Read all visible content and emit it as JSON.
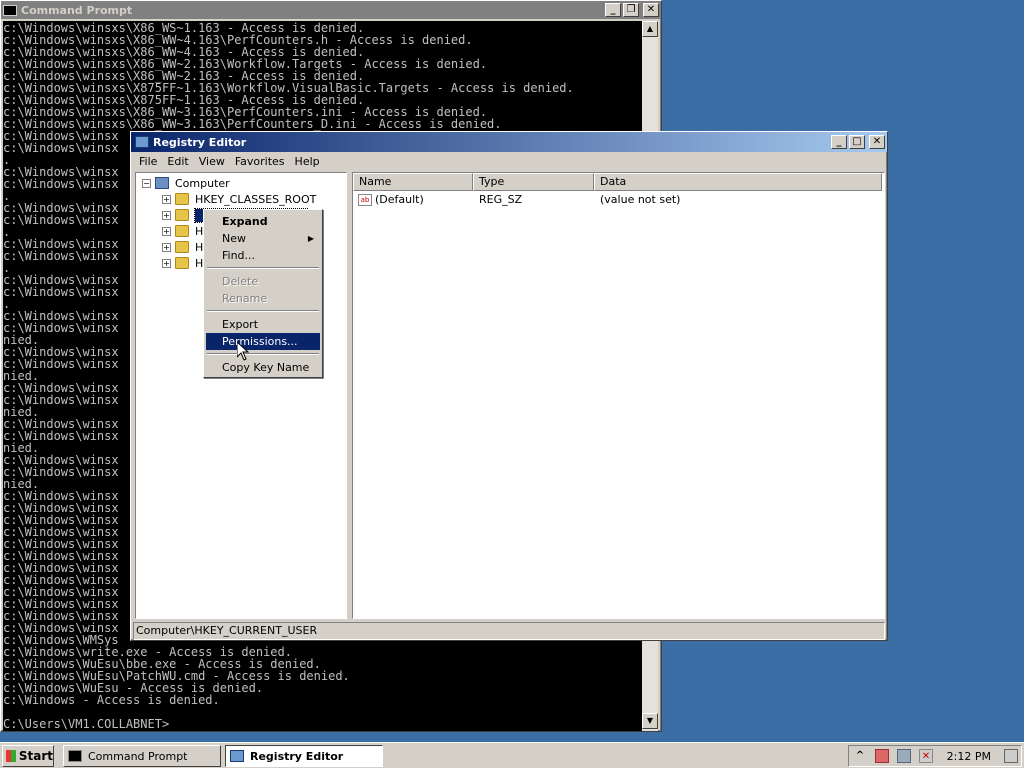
{
  "cmd": {
    "title": "Command Prompt",
    "lines": [
      "c:\\Windows\\winsxs\\X86_WS~1.163 - Access is denied.",
      "c:\\Windows\\winsxs\\X86_WW~4.163\\PerfCounters.h - Access is denied.",
      "c:\\Windows\\winsxs\\X86_WW~4.163 - Access is denied.",
      "c:\\Windows\\winsxs\\X86_WW~2.163\\Workflow.Targets - Access is denied.",
      "c:\\Windows\\winsxs\\X86_WW~2.163 - Access is denied.",
      "c:\\Windows\\winsxs\\X875FF~1.163\\Workflow.VisualBasic.Targets - Access is denied.",
      "c:\\Windows\\winsxs\\X875FF~1.163 - Access is denied.",
      "c:\\Windows\\winsxs\\X86_WW~3.163\\PerfCounters.ini - Access is denied.",
      "c:\\Windows\\winsxs\\X86_WW~3.163\\PerfCounters_D.ini - Access is denied.",
      "c:\\Windows\\winsx",
      "c:\\Windows\\winsx",
      ".",
      "c:\\Windows\\winsx",
      "c:\\Windows\\winsx",
      ".",
      "c:\\Windows\\winsx",
      "c:\\Windows\\winsx",
      ".",
      "c:\\Windows\\winsx",
      "c:\\Windows\\winsx",
      ".",
      "c:\\Windows\\winsx",
      "c:\\Windows\\winsx",
      ".",
      "c:\\Windows\\winsx",
      "c:\\Windows\\winsx",
      "nied.",
      "c:\\Windows\\winsx",
      "c:\\Windows\\winsx",
      "nied.",
      "c:\\Windows\\winsx",
      "c:\\Windows\\winsx",
      "nied.",
      "c:\\Windows\\winsx",
      "c:\\Windows\\winsx",
      "nied.",
      "c:\\Windows\\winsx",
      "c:\\Windows\\winsx",
      "nied.",
      "c:\\Windows\\winsx",
      "c:\\Windows\\winsx",
      "c:\\Windows\\winsx",
      "c:\\Windows\\winsx",
      "c:\\Windows\\winsx",
      "c:\\Windows\\winsx",
      "c:\\Windows\\winsx",
      "c:\\Windows\\winsx",
      "c:\\Windows\\winsx",
      "c:\\Windows\\winsx",
      "c:\\Windows\\winsx",
      "c:\\Windows\\winsx",
      "c:\\Windows\\WMSys",
      "c:\\Windows\\write.exe - Access is denied.",
      "c:\\Windows\\WuEsu\\bbe.exe - Access is denied.",
      "c:\\Windows\\WuEsu\\PatchWU.cmd - Access is denied.",
      "c:\\Windows\\WuEsu - Access is denied.",
      "c:\\Windows - Access is denied.",
      "",
      "C:\\Users\\VM1.COLLABNET>"
    ]
  },
  "regedit": {
    "title": "Registry Editor",
    "menu": [
      "File",
      "Edit",
      "View",
      "Favorites",
      "Help"
    ],
    "tree": {
      "root": "Computer",
      "items": [
        "HKEY_CLASSES_ROOT",
        "H",
        "H",
        "H",
        "H"
      ]
    },
    "columns": [
      "Name",
      "Type",
      "Data"
    ],
    "rows": [
      {
        "name": "(Default)",
        "type": "REG_SZ",
        "data": "(value not set)"
      }
    ],
    "status": "Computer\\HKEY_CURRENT_USER"
  },
  "context_menu": {
    "expand": "Expand",
    "new": "New",
    "find": "Find...",
    "delete": "Delete",
    "rename": "Rename",
    "export": "Export",
    "permissions": "Permissions...",
    "copy_key_name": "Copy Key Name"
  },
  "taskbar": {
    "start": "Start",
    "tasks": [
      "Command Prompt",
      "Registry Editor"
    ],
    "clock": "2:12 PM"
  },
  "icons": {
    "minimize": "_",
    "maximize": "□",
    "restore": "❐",
    "close": "✕",
    "scroll_up": "▲",
    "scroll_down": "▼",
    "submenu": "▶",
    "expand_plus": "+",
    "collapse_minus": "−",
    "reg_string": "ab",
    "tray_chevron": "^"
  }
}
